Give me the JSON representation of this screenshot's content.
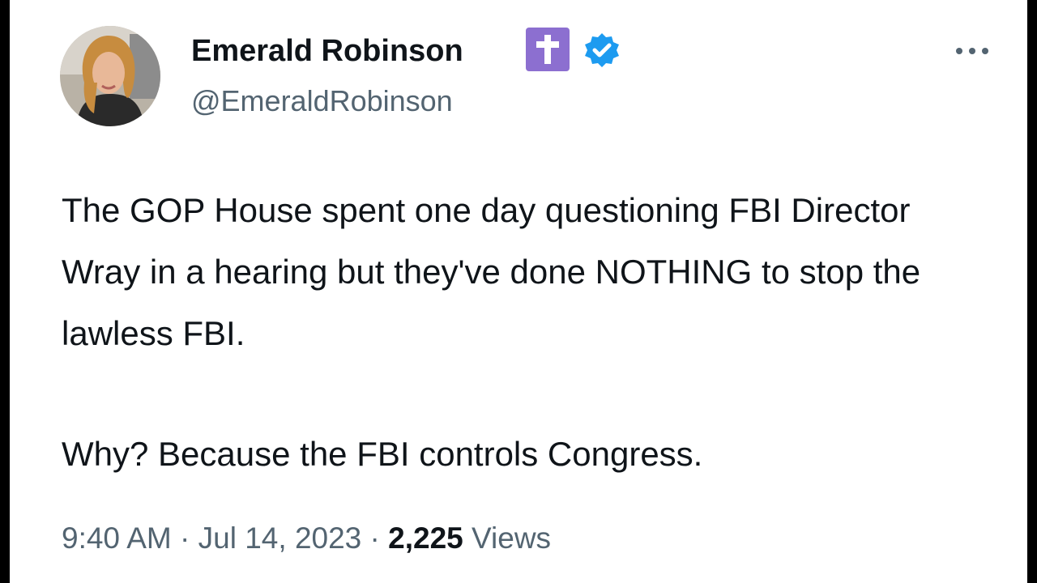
{
  "author": {
    "display_name": "Emerald Robinson",
    "handle": "@EmeraldRobinson",
    "badge_icon": "latin-cross-icon",
    "verified_icon": "verified-check-icon",
    "badge_color": "#8c6fd0",
    "verified_color": "#1d9bf0"
  },
  "tweet": {
    "paragraphs": [
      "The GOP House spent one day questioning FBI Director Wray in a hearing but they've done NOTHING to stop the lawless FBI.",
      "Why? Because the FBI controls Congress."
    ]
  },
  "meta": {
    "time": "9:40 AM",
    "separator": "·",
    "date": "Jul 14, 2023",
    "views_count": "2,225",
    "views_label": "Views"
  },
  "more_menu_icon": "more-options-icon"
}
